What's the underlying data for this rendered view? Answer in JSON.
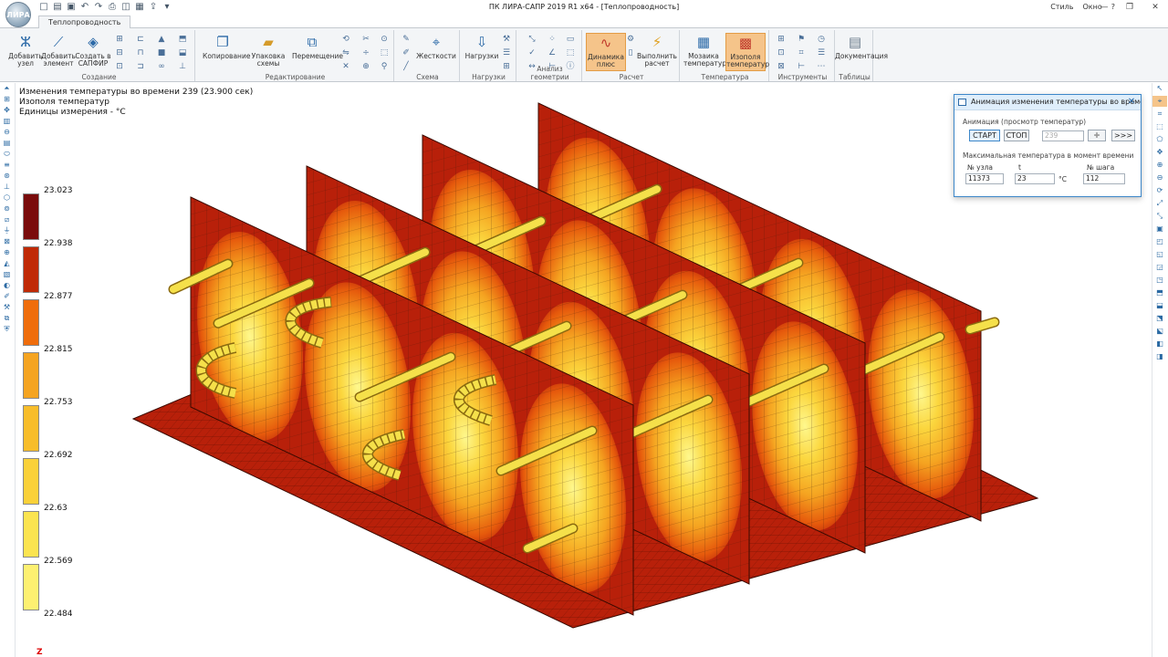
{
  "window": {
    "app_icon_text": "ЛИРА",
    "title": "ПК ЛИРА-САПР  2019 R1 x64 - [Теплопроводность]",
    "right_menu": [
      "Стиль",
      "Окно",
      "?"
    ],
    "controls": [
      "—",
      "❐",
      "✕"
    ]
  },
  "tabs": {
    "active": "Теплопроводность"
  },
  "ribbon": {
    "groups": [
      {
        "label": "Создание",
        "buttons": [
          {
            "label": "Добавить узел",
            "icon": "node-icon"
          },
          {
            "label": "Добавить элемент",
            "icon": "element-icon"
          },
          {
            "label": "Создать в САПФИР",
            "icon": "sapfir-icon"
          }
        ]
      },
      {
        "label": "Редактирование",
        "buttons": [
          {
            "label": "Копирование",
            "icon": "copy-icon"
          },
          {
            "label": "Упаковка схемы",
            "icon": "pack-icon"
          },
          {
            "label": "Перемещение",
            "icon": "move-icon"
          }
        ]
      },
      {
        "label": "Схема",
        "buttons": [
          {
            "label": "Жесткости",
            "icon": "stiffness-icon"
          }
        ]
      },
      {
        "label": "Нагрузки",
        "buttons": [
          {
            "label": "Нагрузки",
            "icon": "loads-icon"
          }
        ]
      },
      {
        "label": "Анализ геометрии",
        "buttons": []
      },
      {
        "label": "Расчет",
        "buttons": [
          {
            "label": "Динамика плюс",
            "icon": "dynamics-icon",
            "active": true
          },
          {
            "label": "Выполнить расчет",
            "icon": "run-icon"
          }
        ]
      },
      {
        "label": "Температура",
        "buttons": [
          {
            "label": "Мозаика температур",
            "icon": "mosaic-icon"
          },
          {
            "label": "Изополя температур",
            "icon": "isofield-icon",
            "active": true
          }
        ]
      },
      {
        "label": "Инструменты",
        "buttons": []
      },
      {
        "label": "Таблицы",
        "buttons": [
          {
            "label": "Документация",
            "icon": "docs-icon"
          }
        ]
      }
    ]
  },
  "viewport": {
    "info_line1": "Изменения температуры во времени 239 (23.900 сек)",
    "info_line2": "Изополя температур",
    "info_line3": "Единицы измерения - °С",
    "legend": {
      "values": [
        "23.023",
        "22.938",
        "22.877",
        "22.815",
        "22.753",
        "22.692",
        "22.63",
        "22.569",
        "22.484"
      ],
      "colors": [
        "#7a0c0c",
        "#c02a06",
        "#ef6d0c",
        "#f5a421",
        "#f8bd2a",
        "#fad139",
        "#fbe450",
        "#fdf071",
        "#fef88e"
      ]
    },
    "axis_label": "Z"
  },
  "dialog": {
    "title": "Анимация изменения температуры во времени",
    "section1": "Анимация (просмотр температур)",
    "start": "СТАРТ",
    "stop": "СТОП",
    "step_value": "239",
    "next": ">>>",
    "section2": "Максимальная температура в момент времени",
    "node_label": "№ узла",
    "t_label": "t",
    "step_label": "№ шага",
    "node_value": "11373",
    "t_value": "23",
    "t_unit": "°C",
    "step_num": "112"
  },
  "colors": {
    "accent": "#3d87c9",
    "plate_dark": "#b8200a",
    "plate_light": "#f9c23a",
    "pipe": "#f5e04a"
  }
}
